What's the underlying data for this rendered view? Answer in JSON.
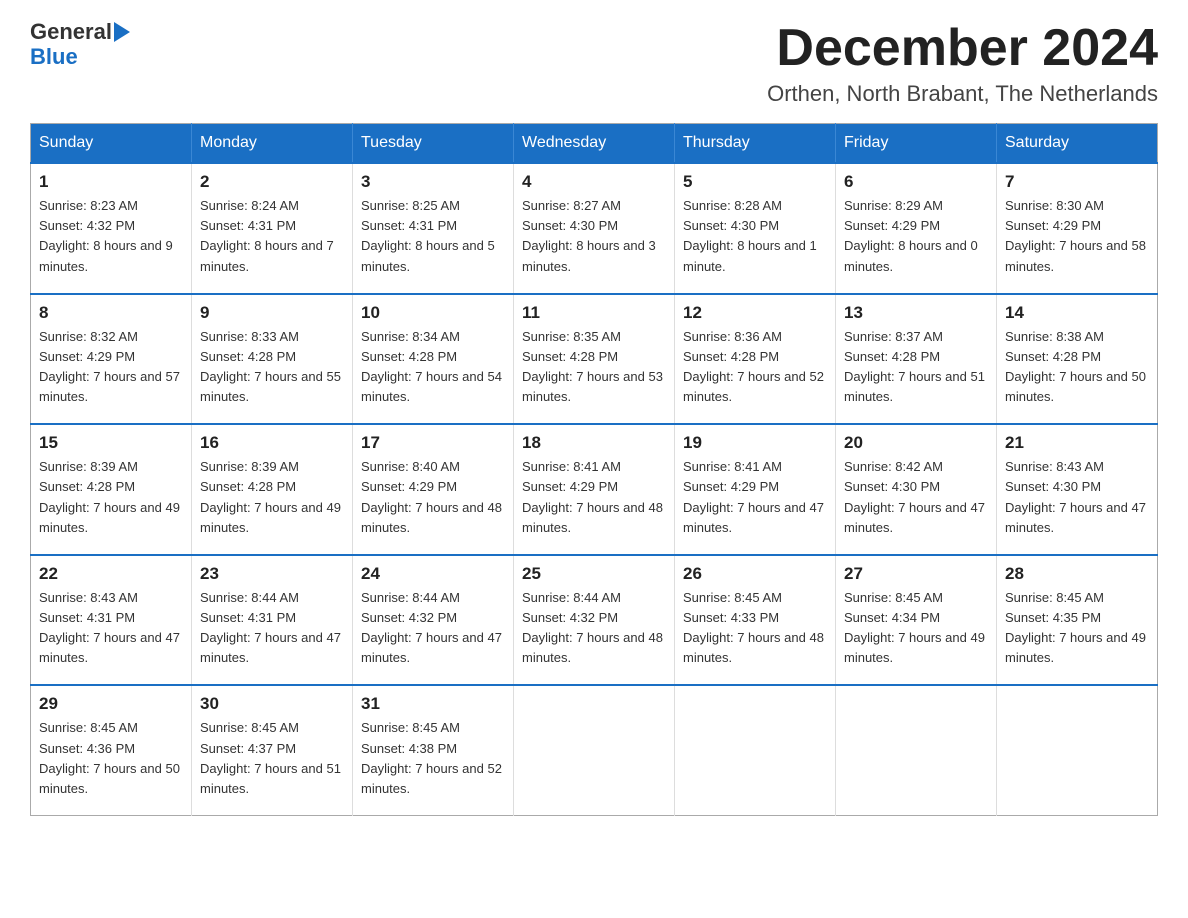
{
  "logo": {
    "line1": "General",
    "arrow": true,
    "line2": "Blue"
  },
  "title": "December 2024",
  "location": "Orthen, North Brabant, The Netherlands",
  "days_of_week": [
    "Sunday",
    "Monday",
    "Tuesday",
    "Wednesday",
    "Thursday",
    "Friday",
    "Saturday"
  ],
  "weeks": [
    [
      {
        "day": "1",
        "sunrise": "8:23 AM",
        "sunset": "4:32 PM",
        "daylight": "8 hours and 9 minutes."
      },
      {
        "day": "2",
        "sunrise": "8:24 AM",
        "sunset": "4:31 PM",
        "daylight": "8 hours and 7 minutes."
      },
      {
        "day": "3",
        "sunrise": "8:25 AM",
        "sunset": "4:31 PM",
        "daylight": "8 hours and 5 minutes."
      },
      {
        "day": "4",
        "sunrise": "8:27 AM",
        "sunset": "4:30 PM",
        "daylight": "8 hours and 3 minutes."
      },
      {
        "day": "5",
        "sunrise": "8:28 AM",
        "sunset": "4:30 PM",
        "daylight": "8 hours and 1 minute."
      },
      {
        "day": "6",
        "sunrise": "8:29 AM",
        "sunset": "4:29 PM",
        "daylight": "8 hours and 0 minutes."
      },
      {
        "day": "7",
        "sunrise": "8:30 AM",
        "sunset": "4:29 PM",
        "daylight": "7 hours and 58 minutes."
      }
    ],
    [
      {
        "day": "8",
        "sunrise": "8:32 AM",
        "sunset": "4:29 PM",
        "daylight": "7 hours and 57 minutes."
      },
      {
        "day": "9",
        "sunrise": "8:33 AM",
        "sunset": "4:28 PM",
        "daylight": "7 hours and 55 minutes."
      },
      {
        "day": "10",
        "sunrise": "8:34 AM",
        "sunset": "4:28 PM",
        "daylight": "7 hours and 54 minutes."
      },
      {
        "day": "11",
        "sunrise": "8:35 AM",
        "sunset": "4:28 PM",
        "daylight": "7 hours and 53 minutes."
      },
      {
        "day": "12",
        "sunrise": "8:36 AM",
        "sunset": "4:28 PM",
        "daylight": "7 hours and 52 minutes."
      },
      {
        "day": "13",
        "sunrise": "8:37 AM",
        "sunset": "4:28 PM",
        "daylight": "7 hours and 51 minutes."
      },
      {
        "day": "14",
        "sunrise": "8:38 AM",
        "sunset": "4:28 PM",
        "daylight": "7 hours and 50 minutes."
      }
    ],
    [
      {
        "day": "15",
        "sunrise": "8:39 AM",
        "sunset": "4:28 PM",
        "daylight": "7 hours and 49 minutes."
      },
      {
        "day": "16",
        "sunrise": "8:39 AM",
        "sunset": "4:28 PM",
        "daylight": "7 hours and 49 minutes."
      },
      {
        "day": "17",
        "sunrise": "8:40 AM",
        "sunset": "4:29 PM",
        "daylight": "7 hours and 48 minutes."
      },
      {
        "day": "18",
        "sunrise": "8:41 AM",
        "sunset": "4:29 PM",
        "daylight": "7 hours and 48 minutes."
      },
      {
        "day": "19",
        "sunrise": "8:41 AM",
        "sunset": "4:29 PM",
        "daylight": "7 hours and 47 minutes."
      },
      {
        "day": "20",
        "sunrise": "8:42 AM",
        "sunset": "4:30 PM",
        "daylight": "7 hours and 47 minutes."
      },
      {
        "day": "21",
        "sunrise": "8:43 AM",
        "sunset": "4:30 PM",
        "daylight": "7 hours and 47 minutes."
      }
    ],
    [
      {
        "day": "22",
        "sunrise": "8:43 AM",
        "sunset": "4:31 PM",
        "daylight": "7 hours and 47 minutes."
      },
      {
        "day": "23",
        "sunrise": "8:44 AM",
        "sunset": "4:31 PM",
        "daylight": "7 hours and 47 minutes."
      },
      {
        "day": "24",
        "sunrise": "8:44 AM",
        "sunset": "4:32 PM",
        "daylight": "7 hours and 47 minutes."
      },
      {
        "day": "25",
        "sunrise": "8:44 AM",
        "sunset": "4:32 PM",
        "daylight": "7 hours and 48 minutes."
      },
      {
        "day": "26",
        "sunrise": "8:45 AM",
        "sunset": "4:33 PM",
        "daylight": "7 hours and 48 minutes."
      },
      {
        "day": "27",
        "sunrise": "8:45 AM",
        "sunset": "4:34 PM",
        "daylight": "7 hours and 49 minutes."
      },
      {
        "day": "28",
        "sunrise": "8:45 AM",
        "sunset": "4:35 PM",
        "daylight": "7 hours and 49 minutes."
      }
    ],
    [
      {
        "day": "29",
        "sunrise": "8:45 AM",
        "sunset": "4:36 PM",
        "daylight": "7 hours and 50 minutes."
      },
      {
        "day": "30",
        "sunrise": "8:45 AM",
        "sunset": "4:37 PM",
        "daylight": "7 hours and 51 minutes."
      },
      {
        "day": "31",
        "sunrise": "8:45 AM",
        "sunset": "4:38 PM",
        "daylight": "7 hours and 52 minutes."
      },
      null,
      null,
      null,
      null
    ]
  ]
}
